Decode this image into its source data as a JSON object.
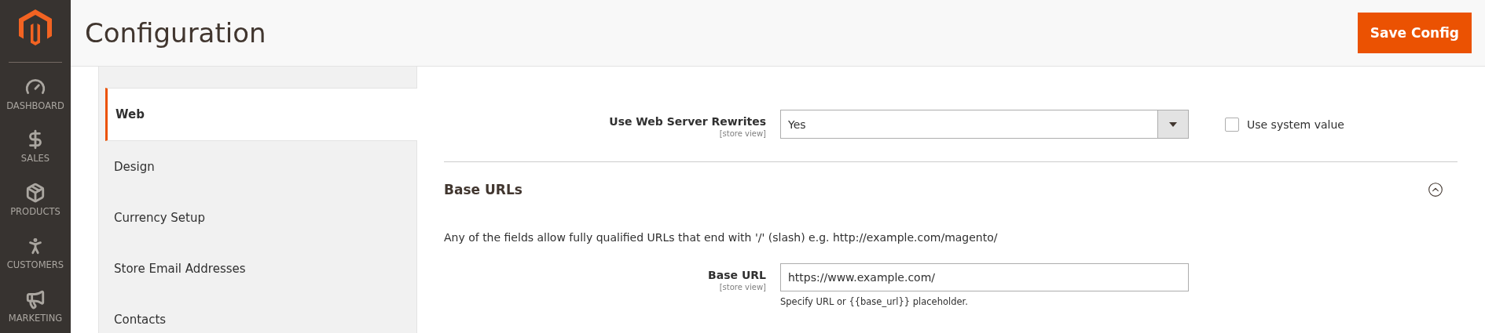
{
  "nav": {
    "items": [
      {
        "label": "DASHBOARD",
        "kind": "dashboard"
      },
      {
        "label": "SALES",
        "kind": "sales"
      },
      {
        "label": "PRODUCTS",
        "kind": "products"
      },
      {
        "label": "CUSTOMERS",
        "kind": "customers"
      },
      {
        "label": "MARKETING",
        "kind": "marketing"
      }
    ]
  },
  "header": {
    "title": "Configuration",
    "save_button": "Save Config"
  },
  "sidebar": {
    "items": [
      {
        "label": "Web",
        "selected": true
      },
      {
        "label": "Design",
        "selected": false
      },
      {
        "label": "Currency Setup",
        "selected": false
      },
      {
        "label": "Store Email Addresses",
        "selected": false
      },
      {
        "label": "Contacts",
        "selected": false
      }
    ]
  },
  "seo_section": {
    "fields": [
      {
        "kind": "select",
        "label": "Use Web Server Rewrites",
        "scope": "[store view]",
        "value": "Yes",
        "use_system_value": {
          "label": "Use system value",
          "checked": false
        }
      }
    ]
  },
  "base_urls_section": {
    "title": "Base URLs",
    "expanded": true,
    "description": "Any of the fields allow fully qualified URLs that end with '/' (slash) e.g. http://example.com/magento/",
    "fields": [
      {
        "kind": "text",
        "label": "Base URL",
        "scope": "[store view]",
        "value": "https://www.example.com/",
        "note": "Specify URL or {{base_url}} placeholder."
      }
    ]
  }
}
